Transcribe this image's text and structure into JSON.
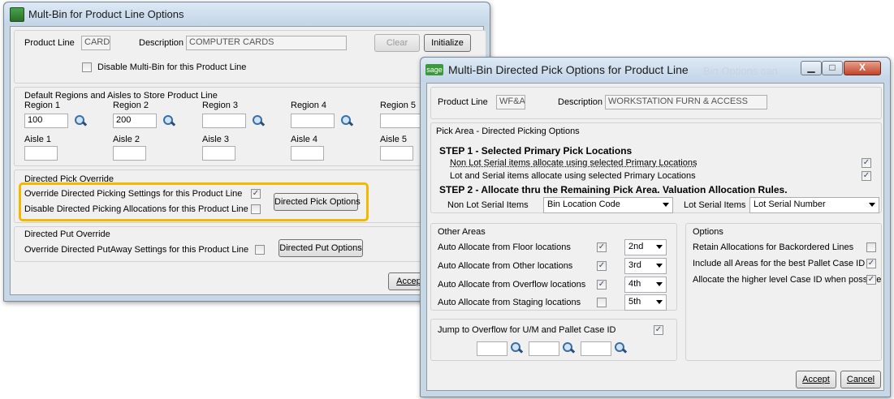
{
  "back_window": {
    "title": "Mult-Bin for Product Line Options",
    "header": {
      "product_line_label": "Product Line",
      "product_line_value": "CARD",
      "description_label": "Description",
      "description_value": "COMPUTER CARDS",
      "clear_label": "Clear",
      "initialize_label": "Initialize",
      "disable_multibin_label": "Disable Multi-Bin for this Product Line"
    },
    "regions": {
      "group_label": "Default Regions and Aisles to Store Product Line",
      "region_labels": [
        "Region 1",
        "Region 2",
        "Region 3",
        "Region 4",
        "Region 5"
      ],
      "region_values": [
        "100",
        "200",
        "",
        "",
        ""
      ],
      "aisle_labels": [
        "Aisle 1",
        "Aisle 2",
        "Aisle 3",
        "Aisle 4",
        "Aisle 5"
      ]
    },
    "pick_override": {
      "group_label": "Directed Pick Override",
      "override_label": "Override Directed Picking Settings for this Product Line",
      "override_checked": "✓",
      "disable_label": "Disable Directed Picking Allocations for this Product Line",
      "button_label": "Directed Pick Options"
    },
    "put_override": {
      "group_label": "Directed Put Override",
      "override_label": "Override Directed PutAway Settings for this Product Line",
      "button_label": "Directed Put Options"
    },
    "accept_label": "Accept",
    "highlight_color": "#f5b800"
  },
  "front_window": {
    "title": "Multi-Bin Directed Pick Options for Product Line",
    "title_ghost": "Bin Options can",
    "sage_logo": "sage",
    "header": {
      "product_line_label": "Product Line",
      "product_line_value": "WF&A",
      "description_label": "Description",
      "description_value": "WORKSTATION FURN & ACCESS"
    },
    "pick_area": {
      "group_label": "Pick Area - Directed Picking Options",
      "step1_title": "STEP 1 - Selected Primary Pick Locations",
      "step1_items": [
        "Non Lot Serial items allocate using selected Primary Locations",
        "Lot and Serial items allocate using selected Primary Locations"
      ],
      "step2_title": "STEP 2 - Allocate thru the Remaining Pick Area.  Valuation Allocation Rules.",
      "non_lot_label": "Non Lot Serial Items",
      "non_lot_value": "Bin Location Code",
      "lot_label": "Lot Serial Items",
      "lot_value": "Lot Serial Number"
    },
    "other_areas": {
      "group_label": "Other Areas",
      "rows": [
        {
          "label": "Auto Allocate from Floor locations",
          "checked": "✓",
          "value": "2nd"
        },
        {
          "label": "Auto Allocate from Other locations",
          "checked": "✓",
          "value": "3rd"
        },
        {
          "label": "Auto Allocate from Overflow locations",
          "checked": "✓",
          "value": "4th"
        },
        {
          "label": "Auto Allocate from Staging locations",
          "checked": "",
          "value": "5th"
        }
      ]
    },
    "options": {
      "group_label": "Options",
      "rows": [
        {
          "label": "Retain Allocations for Backordered Lines",
          "checked": ""
        },
        {
          "label": "Include all Areas for the best Pallet Case ID",
          "checked": "✓"
        },
        {
          "label": "Allocate the higher level Case ID when possible",
          "checked": "✓"
        }
      ]
    },
    "jump": {
      "label": "Jump to Overflow for U/M and Pallet Case ID",
      "checked": "✓"
    },
    "accept_label": "Accept",
    "cancel_label": "Cancel"
  }
}
